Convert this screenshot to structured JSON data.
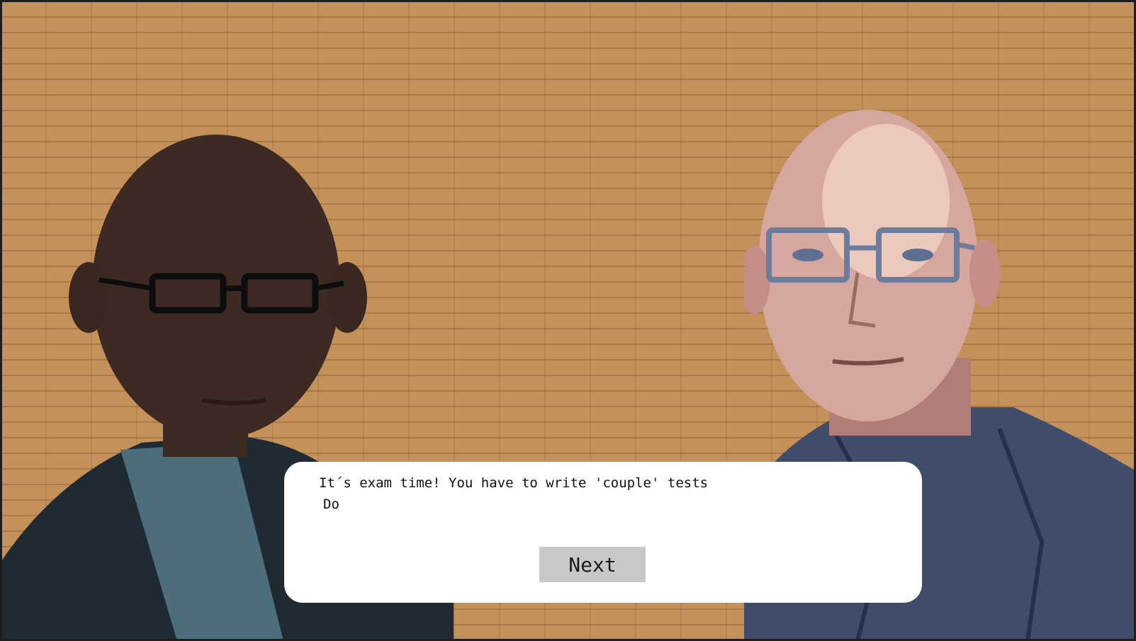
{
  "scene": {
    "background": "brick-wall",
    "wall_color": "#c4915a"
  },
  "characters": [
    {
      "position": "left",
      "portrait": "bald-man-dark-suit-glasses",
      "highlighted": false
    },
    {
      "position": "right",
      "portrait": "bald-man-dark-shirt-glasses",
      "highlighted": true
    }
  ],
  "dialog": {
    "line1": "It´s exam time! You have to write 'couple' tests",
    "line2": "Do",
    "next_label": "Next"
  }
}
